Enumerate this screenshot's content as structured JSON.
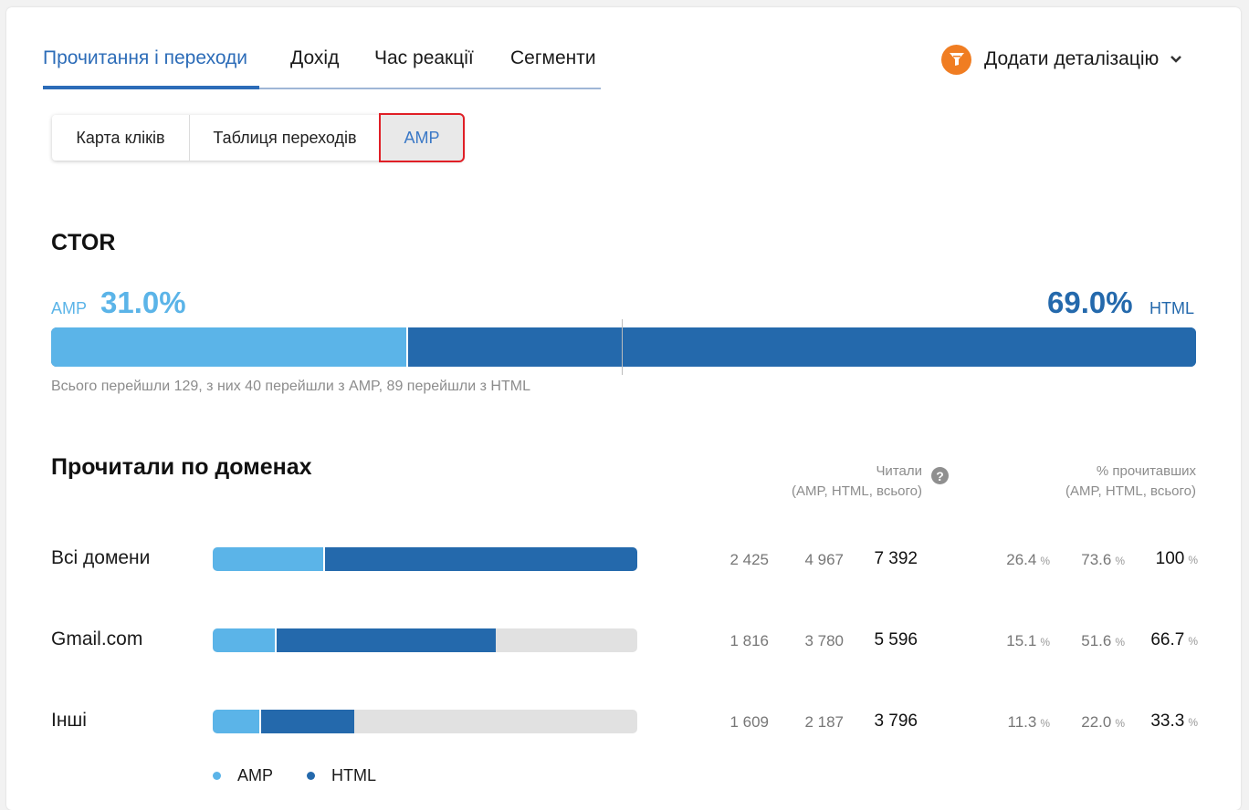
{
  "tabs": [
    {
      "label": "Прочитання і переходи",
      "active": true
    },
    {
      "label": "Дохід"
    },
    {
      "label": "Час реакції"
    },
    {
      "label": "Сегменти"
    }
  ],
  "detail_button": {
    "label": "Додати деталізацію",
    "icon": "funnel-icon"
  },
  "subtabs": [
    {
      "label": "Карта кліків"
    },
    {
      "label": "Таблиця переходів"
    },
    {
      "label": "AMP",
      "selected": true
    }
  ],
  "ctor": {
    "title": "CTOR",
    "amp_label": "AMP",
    "amp_value": "31.0%",
    "amp_fraction": 0.31,
    "html_label": "HTML",
    "html_value": "69.0%",
    "note": "Всього перейшли 129, з них 40 перейшли з AMP, 89 перейшли з HTML"
  },
  "domains": {
    "title": "Прочитали по доменах",
    "col_read_title": "Читали",
    "col_read_sub": "(AMP, HTML, всього)",
    "col_pct_title": "% прочитавших",
    "col_pct_sub": "(AMP, HTML, всього)",
    "pct_sign": "%",
    "rows": [
      {
        "name": "Всі домени",
        "amp": "2 425",
        "html": "4 967",
        "total": "7 392",
        "amp_pct": "26.4",
        "html_pct": "73.6",
        "total_pct": "100",
        "amp_share": 0.264,
        "html_share": 0.736
      },
      {
        "name": "Gmail.com",
        "amp": "1 816",
        "html": "3 780",
        "total": "5 596",
        "amp_pct": "15.1",
        "html_pct": "51.6",
        "total_pct": "66.7",
        "amp_share": 0.151,
        "html_share": 0.516
      },
      {
        "name": "Інші",
        "amp": "1 609",
        "html": "2 187",
        "total": "3 796",
        "amp_pct": "11.3",
        "html_pct": "22.0",
        "total_pct": "33.3",
        "amp_share": 0.113,
        "html_share": 0.22
      }
    ]
  },
  "legend": [
    {
      "label": "AMP",
      "color": "#5bb4e8"
    },
    {
      "label": "HTML",
      "color": "#2469ac"
    }
  ],
  "colors": {
    "accent": "#2c6cb8",
    "amp": "#5bb4e8",
    "html": "#2469ac",
    "funnel": "#f07d22",
    "highlight": "#e01f26"
  }
}
